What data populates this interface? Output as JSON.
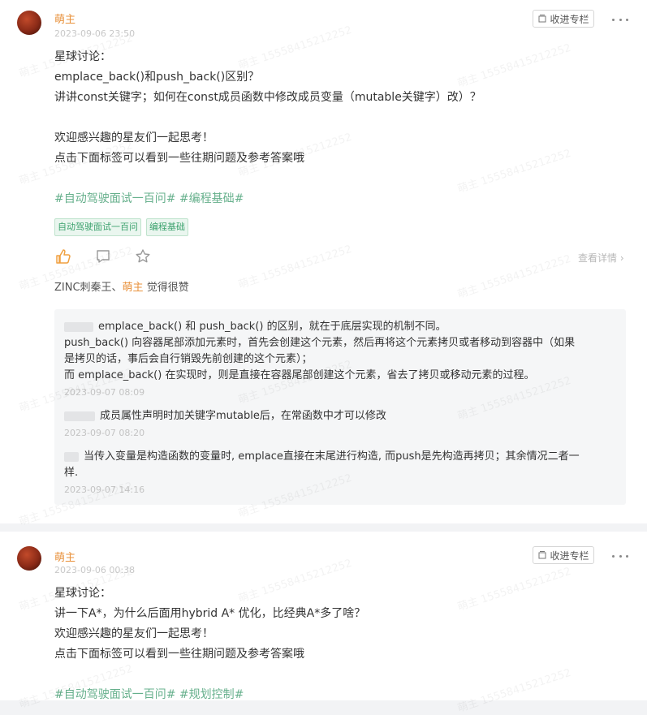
{
  "posts": [
    {
      "author": "萌主",
      "time": "2023-09-06 23:50",
      "collect_label": "收进专栏",
      "lines": [
        "星球讨论：",
        "emplace_back()和push_back()区别？",
        "讲讲const关键字；如何在const成员函数中修改成员变量（mutable关键字）改）？",
        "",
        "欢迎感兴趣的星友们一起思考！",
        "点击下面标签可以看到一些往期问题及参考答案哦",
        ""
      ],
      "hashtags": "#自动驾驶面试一百问# #编程基础#",
      "tags": [
        "自动驾驶面试一百问",
        "编程基础"
      ],
      "view_detail": "查看详情",
      "liked": {
        "names": "ZINC刺秦王、",
        "owner": "萌主",
        "suffix": " 觉得很赞"
      },
      "comments": [
        {
          "lines": [
            "emplace_back() 和 push_back() 的区别，就在于底层实现的机制不同。",
            "push_back() 向容器尾部添加元素时，首先会创建这个元素，然后再将这个元素拷贝或者移动到容器中（如果",
            "是拷贝的话，事后会自行销毁先前创建的这个元素）；",
            "而 emplace_back() 在实现时，则是直接在容器尾部创建这个元素，省去了拷贝或移动元素的过程。"
          ],
          "time": "2023-09-07 08:09"
        },
        {
          "lines": [
            "成员属性声明时加关键字mutable后，在常函数中才可以修改"
          ],
          "time": "2023-09-07 08:20"
        },
        {
          "lines": [
            "当传入变量是构造函数的变量时, emplace直接在末尾进行构造, 而push是先构造再拷贝；其余情况二者一",
            "样."
          ],
          "time": "2023-09-07 14:16"
        }
      ]
    },
    {
      "author": "萌主",
      "time": "2023-09-06 00:38",
      "collect_label": "收进专栏",
      "lines": [
        "星球讨论：",
        "讲一下A*，为什么后面用hybrid A* 优化，比经典A*多了啥？",
        "欢迎感兴趣的星友们一起思考！",
        "点击下面标签可以看到一些往期问题及参考答案哦",
        ""
      ],
      "hashtags": "#自动驾驶面试一百问# #规划控制#"
    }
  ],
  "watermark_text": "萌主 15558415212252",
  "colors": {
    "author": "#e8913b",
    "tag_text": "#3ea36f",
    "tag_bg": "#eaf6ef",
    "hashtag": "#66b08c",
    "like_icon": "#f0a040"
  }
}
